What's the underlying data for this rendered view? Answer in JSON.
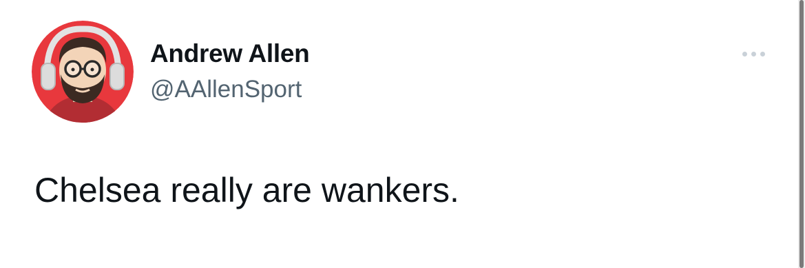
{
  "tweet": {
    "author": {
      "display_name": "Andrew Allen",
      "handle": "@AAllenSport",
      "avatar_icon": "bearded-man-headphones-avatar"
    },
    "text": "Chelsea really are wankers.",
    "more_icon": "ellipsis-icon"
  },
  "colors": {
    "avatar_background": "#e8383d",
    "name_text": "#0f1419",
    "handle_text": "#536471",
    "more_dots": "#c9d1d8"
  }
}
